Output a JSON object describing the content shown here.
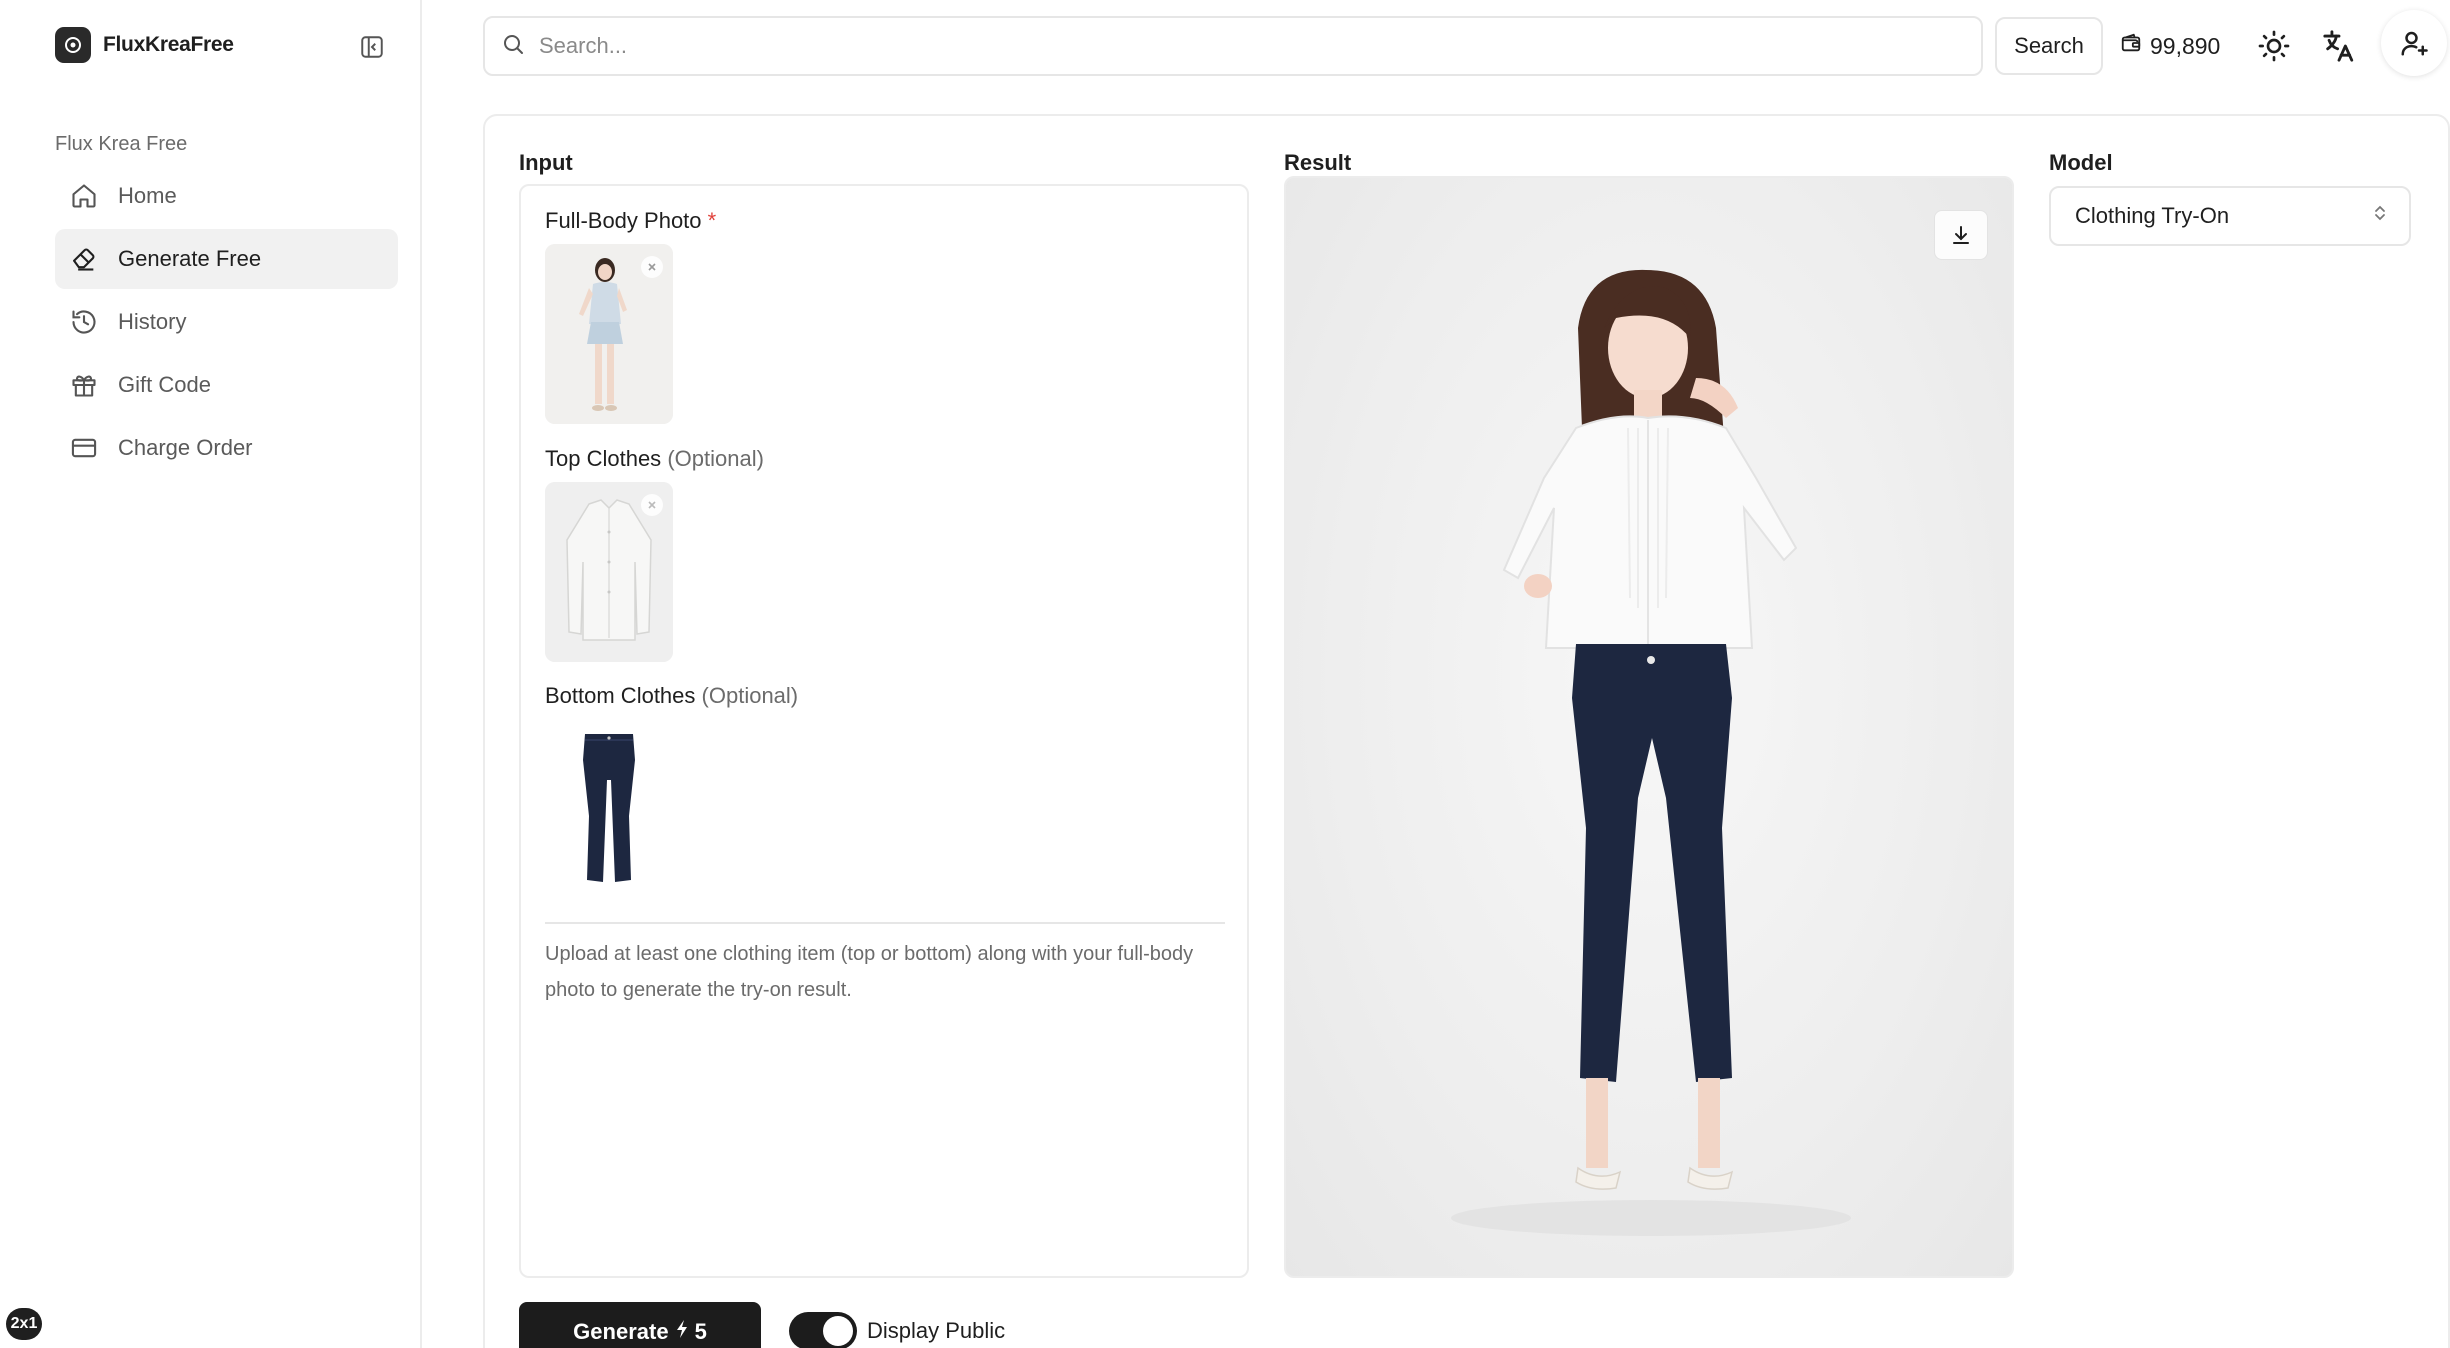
{
  "brand": {
    "name": "FluxKreaFree"
  },
  "sidebar": {
    "section_label": "Flux Krea Free",
    "items": [
      {
        "label": "Home",
        "icon": "home-icon",
        "active": false
      },
      {
        "label": "Generate Free",
        "icon": "eraser-icon",
        "active": true
      },
      {
        "label": "History",
        "icon": "history-icon",
        "active": false
      },
      {
        "label": "Gift Code",
        "icon": "gift-icon",
        "active": false
      },
      {
        "label": "Charge Order",
        "icon": "credit-card-icon",
        "active": false
      }
    ]
  },
  "header": {
    "search_placeholder": "Search...",
    "search_button": "Search",
    "credits": "99,890"
  },
  "input": {
    "title": "Input",
    "full_body_label": "Full-Body Photo",
    "required_mark": "*",
    "top_label": "Top Clothes",
    "bottom_label": "Bottom Clothes",
    "optional": "(Optional)",
    "hint": "Upload at least one clothing item (top or bottom) along with your full-body photo to generate the try-on result."
  },
  "result": {
    "title": "Result"
  },
  "model": {
    "title": "Model",
    "selected": "Clothing Try-On"
  },
  "actions": {
    "generate_label": "Generate",
    "generate_cost": "5",
    "display_public_label": "Display Public",
    "display_public_on": true
  },
  "corner_badge": "2x1",
  "colors": {
    "accent": "#1c1c1c",
    "required": "#e0413a",
    "pants": "#1d2740"
  }
}
